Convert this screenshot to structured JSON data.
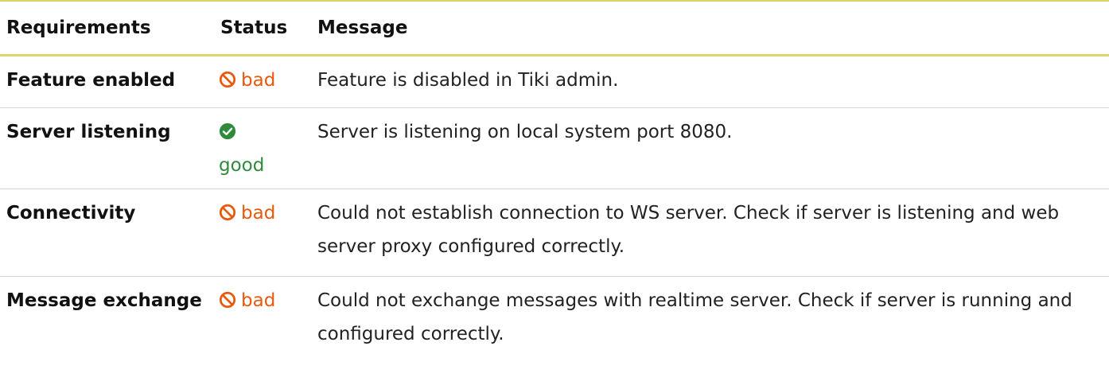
{
  "table": {
    "headers": {
      "requirements": "Requirements",
      "status": "Status",
      "message": "Message"
    },
    "rows": [
      {
        "requirement": "Feature enabled",
        "status": "bad",
        "status_icon": "ban-icon",
        "message": "Feature is disabled in Tiki admin."
      },
      {
        "requirement": "Server listening",
        "status": "good",
        "status_icon": "check-circle-icon",
        "message": "Server is listening on local system port 8080."
      },
      {
        "requirement": "Connectivity",
        "status": "bad",
        "status_icon": "ban-icon",
        "message": "Could not establish connection to WS server. Check if server is listening and web server proxy configured correctly."
      },
      {
        "requirement": "Message exchange",
        "status": "bad",
        "status_icon": "ban-icon",
        "message": "Could not exchange messages with realtime server. Check if server is running and configured correctly."
      }
    ]
  },
  "colors": {
    "bad": "#e8590c",
    "good": "#2f8a3a",
    "accent_border": "#dfd46a"
  }
}
